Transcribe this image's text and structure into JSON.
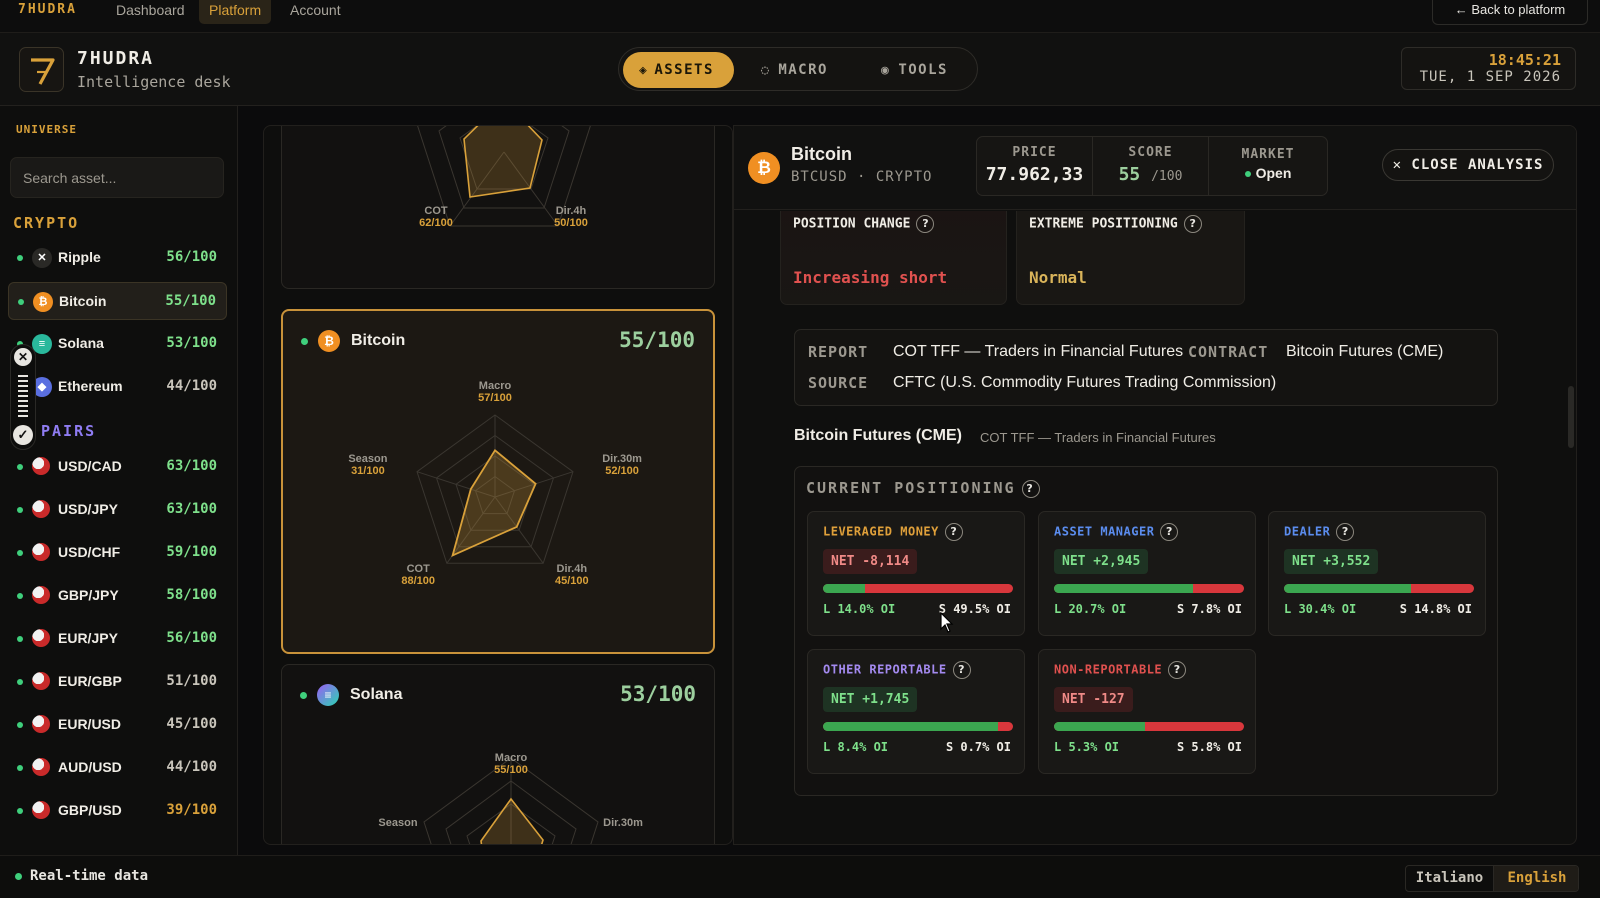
{
  "topnav": {
    "logo": "7HUDRA",
    "links": [
      {
        "label": "Dashboard",
        "active": false
      },
      {
        "label": "Platform",
        "active": true
      },
      {
        "label": "Account",
        "active": false
      }
    ],
    "back": "← Back to platform"
  },
  "header": {
    "brand_name": "7HUDRA",
    "brand_sub": "Intelligence desk",
    "modes": [
      {
        "label": "ASSETS",
        "icon": "diamond-icon",
        "active": true
      },
      {
        "label": "MACRO",
        "icon": "circle-icon",
        "active": false
      },
      {
        "label": "TOOLS",
        "icon": "target-icon",
        "active": false
      }
    ],
    "clock_time": "18:45:21",
    "clock_date": "TUE, 1 SEP 2026"
  },
  "sidebar": {
    "universe_label": "UNIVERSE",
    "search_placeholder": "Search asset...",
    "crypto_label": "CRYPTO",
    "pairs_label": "PAIRS",
    "crypto": [
      {
        "name": "Ripple",
        "score": "56/100",
        "icon": "ripple-icon",
        "active": false
      },
      {
        "name": "Bitcoin",
        "score": "55/100",
        "icon": "bitcoin-icon",
        "active": true
      },
      {
        "name": "Solana",
        "score": "53/100",
        "icon": "solana-icon",
        "active": false
      },
      {
        "name": "Ethereum",
        "score": "44/100",
        "icon": "ethereum-icon",
        "active": false
      }
    ],
    "pairs": [
      {
        "name": "USD/CAD",
        "score": "63/100"
      },
      {
        "name": "USD/JPY",
        "score": "63/100"
      },
      {
        "name": "USD/CHF",
        "score": "59/100"
      },
      {
        "name": "GBP/JPY",
        "score": "58/100"
      },
      {
        "name": "EUR/JPY",
        "score": "56/100"
      },
      {
        "name": "EUR/GBP",
        "score": "51/100"
      },
      {
        "name": "EUR/USD",
        "score": "45/100"
      },
      {
        "name": "AUD/USD",
        "score": "44/100"
      },
      {
        "name": "GBP/USD",
        "score": "39/100"
      }
    ],
    "colors": {
      "good": "#7ee08b",
      "mid": "#c9c5bb",
      "low": "#d9a13a",
      "crypto": "#d9a13a",
      "pairs": "#8f7cf2"
    }
  },
  "cards": {
    "top": {
      "labels": [
        {
          "name": "COT",
          "value": "62/100"
        },
        {
          "name": "Dir.4h",
          "value": "50/100"
        }
      ]
    },
    "bitcoin": {
      "name": "Bitcoin",
      "score": "55/100",
      "axes": [
        {
          "name": "Macro",
          "value": "57/100",
          "v": 57
        },
        {
          "name": "Dir.30m",
          "value": "52/100",
          "v": 52
        },
        {
          "name": "Dir.4h",
          "value": "45/100",
          "v": 45
        },
        {
          "name": "COT",
          "value": "88/100",
          "v": 88
        },
        {
          "name": "Season",
          "value": "31/100",
          "v": 31
        }
      ]
    },
    "solana": {
      "name": "Solana",
      "score": "53/100",
      "axes": [
        {
          "name": "Macro",
          "value": "55/100"
        },
        {
          "name": "Dir.30m",
          "value": ""
        },
        {
          "name": "Season",
          "value": ""
        }
      ]
    }
  },
  "panel": {
    "asset_name": "Bitcoin",
    "ticker": "BTCUSD · CRYPTO",
    "stats": [
      {
        "label": "PRICE",
        "value": "77.962,33"
      },
      {
        "label": "SCORE",
        "value": "55",
        "suffix": "/100"
      },
      {
        "label": "MARKET",
        "value": "Open"
      }
    ],
    "close_label": "✕ CLOSE ANALYSIS",
    "position_change": {
      "label": "POSITION CHANGE",
      "value": "Increasing short"
    },
    "extreme_positioning": {
      "label": "EXTREME POSITIONING",
      "value": "Normal"
    },
    "report": {
      "report_key": "REPORT",
      "report_val": "COT TFF — Traders in Financial Futures",
      "contract_key": "CONTRACT",
      "contract_val": "Bitcoin Futures (CME)",
      "source_key": "SOURCE",
      "source_val": "CFTC (U.S. Commodity Futures Trading Commission)"
    },
    "futures_title": "Bitcoin Futures (CME)",
    "futures_sub": "COT TFF — Traders in Financial Futures",
    "positioning_title": "CURRENT POSITIONING",
    "groups": [
      {
        "title": "LEVERAGED MONEY",
        "net": "NET -8,114",
        "long": "L 14.0% OI",
        "short": "S 49.5% OI",
        "long_share": 0.22,
        "color": "#e0a03a",
        "net_sign": "neg"
      },
      {
        "title": "ASSET MANAGER",
        "net": "NET +2,945",
        "long": "L 20.7% OI",
        "short": "S 7.8% OI",
        "long_share": 0.73,
        "color": "#5b8def",
        "net_sign": "pos"
      },
      {
        "title": "DEALER",
        "net": "NET +3,552",
        "long": "L 30.4% OI",
        "short": "S 14.8% OI",
        "long_share": 0.67,
        "color": "#5b8def",
        "net_sign": "pos"
      },
      {
        "title": "OTHER REPORTABLE",
        "net": "NET +1,745",
        "long": "L 8.4% OI",
        "short": "S 0.7% OI",
        "long_share": 0.92,
        "color": "#a48af0",
        "net_sign": "pos"
      },
      {
        "title": "NON-REPORTABLE",
        "net": "NET -127",
        "long": "L 5.3% OI",
        "short": "S 5.8% OI",
        "long_share": 0.48,
        "color": "#e0514f",
        "net_sign": "neg"
      }
    ]
  },
  "footer": {
    "status": "Real-time data",
    "langs": [
      {
        "label": "Italiano",
        "active": false
      },
      {
        "label": "English",
        "active": true
      }
    ]
  }
}
